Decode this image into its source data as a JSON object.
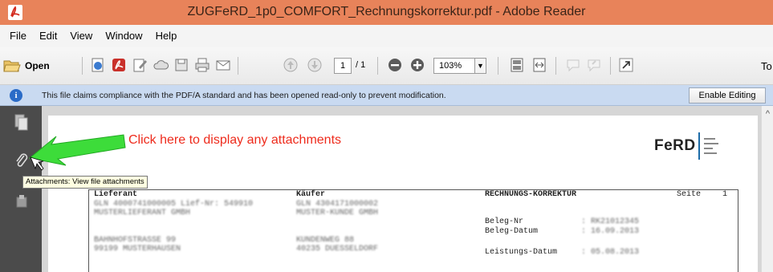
{
  "window": {
    "title": "ZUGFeRD_1p0_COMFORT_Rechnungskorrektur.pdf - Adobe Reader",
    "app_icon": "adobe-reader-icon",
    "titlebar_color": "#e8835a"
  },
  "menubar": {
    "items": [
      "File",
      "Edit",
      "View",
      "Window",
      "Help"
    ]
  },
  "toolbar": {
    "open_label": "Open",
    "page_current": "1",
    "page_total": "/ 1",
    "zoom": "103%",
    "tools_label": "To",
    "icons": [
      "folder-open-icon",
      "create-pdf-icon",
      "acrobat-icon",
      "edit-icon",
      "cloud-icon",
      "save-icon",
      "print-icon",
      "email-icon",
      "page-up-icon",
      "page-down-icon",
      "zoom-out-icon",
      "zoom-in-icon",
      "fit-page-icon",
      "fit-width-icon",
      "comment-icon",
      "highlight-icon",
      "fullscreen-icon"
    ]
  },
  "infobar": {
    "message": "This file claims compliance with the PDF/A standard and has been opened read-only to prevent modification.",
    "button": "Enable Editing",
    "color": "#c9daf1"
  },
  "navpanel": {
    "icons": [
      "page-thumbnails-icon",
      "attachments-paperclip-icon",
      "signatures-icon"
    ]
  },
  "annotation": {
    "text": "Click here to display any attachments",
    "color": "#ee2b1c",
    "arrow_color": "#3ddc3a"
  },
  "tooltip": {
    "text": "Attachments: View file attachments"
  },
  "document": {
    "logo_text": "FeRD",
    "header": {
      "supplier_label": "Lieferant",
      "buyer_label": "Käufer",
      "doc_type": "RECHNUNGS-KORREKTUR",
      "page_label": "Seite",
      "page_no": "1"
    },
    "supplier": {
      "line1": "GLN 4000741000005 Lief-Nr: 549910",
      "line2": "MUSTERLIEFERANT GMBH",
      "line3": "BAHNHOFSTRASSE 99",
      "line4": "99199 MUSTERHAUSEN"
    },
    "buyer": {
      "line1": "GLN 4304171000002",
      "line2": "MUSTER-KUNDE GMBH",
      "line3": "KUNDENWEG 88",
      "line4": "40235 DUESSELDORF"
    },
    "fields": [
      {
        "label": "Beleg-Nr",
        "value": ": RK21012345"
      },
      {
        "label": "Beleg-Datum",
        "value": ": 16.09.2013"
      },
      {
        "label": "Leistungs-Datum",
        "value": ": 05.08.2013"
      }
    ]
  }
}
